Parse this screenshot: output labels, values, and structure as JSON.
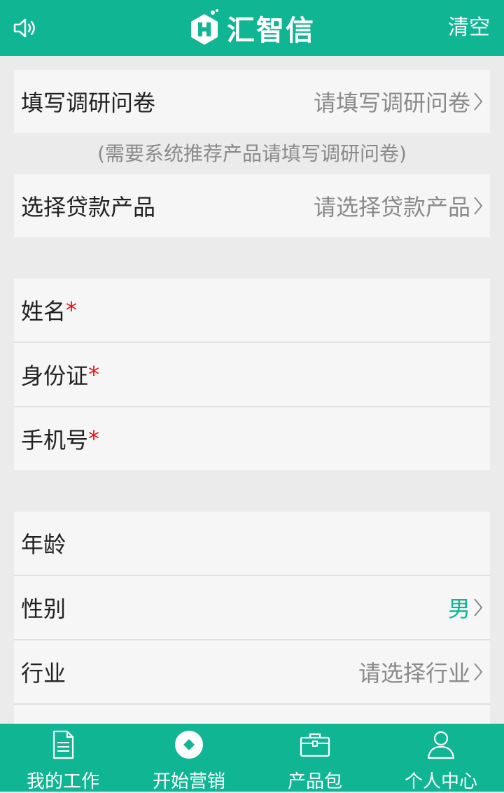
{
  "header": {
    "sound_icon": "speaker-icon",
    "logo_icon": "hexagon-logo-icon",
    "title": "汇智信",
    "clear_label": "清空"
  },
  "survey": {
    "label": "填写调研问卷",
    "placeholder": "请填写调研问卷",
    "note": "(需要系统推荐产品请填写调研问卷)"
  },
  "product": {
    "label": "选择贷款产品",
    "placeholder": "请选择贷款产品"
  },
  "required_fields": [
    {
      "label": "姓名",
      "mark": "*"
    },
    {
      "label": "身份证",
      "mark": "*"
    },
    {
      "label": "手机号",
      "mark": "*"
    }
  ],
  "optional_fields": {
    "age": {
      "label": "年龄"
    },
    "gender": {
      "label": "性别",
      "value": "男"
    },
    "industry": {
      "label": "行业",
      "placeholder": "请选择行业"
    }
  },
  "tabs": [
    {
      "label": "我的工作",
      "icon": "document-icon"
    },
    {
      "label": "开始营销",
      "icon": "compass-icon"
    },
    {
      "label": "产品包",
      "icon": "briefcase-icon"
    },
    {
      "label": "个人中心",
      "icon": "user-icon"
    }
  ],
  "colors": {
    "brand": "#10b594",
    "required": "#e8131b",
    "placeholder": "#8a8a8a"
  }
}
